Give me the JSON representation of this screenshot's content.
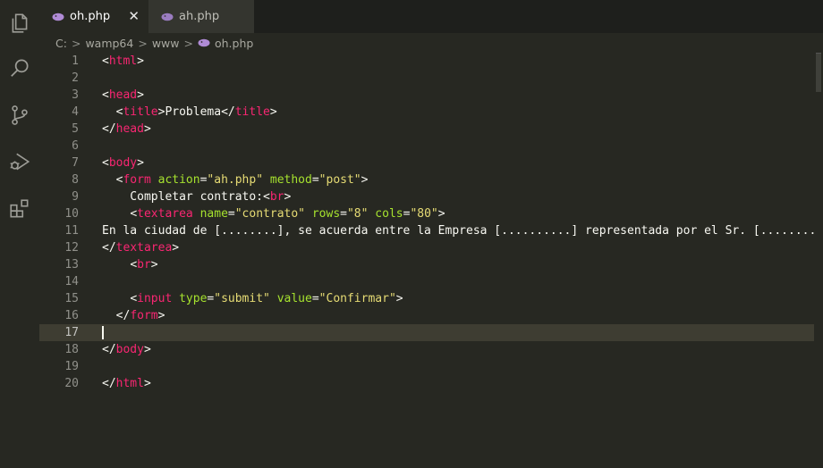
{
  "tabs": [
    {
      "label": "oh.php",
      "active": true
    },
    {
      "label": "ah.php",
      "active": false
    }
  ],
  "close_glyph": "✕",
  "breadcrumb": {
    "items": [
      "C:",
      "wamp64",
      "www",
      "oh.php"
    ],
    "separator": ">"
  },
  "editor": {
    "current_line": 17,
    "lines": [
      {
        "n": "1",
        "text": "<html>"
      },
      {
        "n": "2",
        "text": ""
      },
      {
        "n": "3",
        "text": "<head>"
      },
      {
        "n": "4",
        "text": "  <title>Problema</title>"
      },
      {
        "n": "5",
        "text": "</head>"
      },
      {
        "n": "6",
        "text": ""
      },
      {
        "n": "7",
        "text": "<body>"
      },
      {
        "n": "8",
        "text": "  <form action=\"ah.php\" method=\"post\">"
      },
      {
        "n": "9",
        "text": "    Completar contrato:<br>"
      },
      {
        "n": "10",
        "text": "    <textarea name=\"contrato\" rows=\"8\" cols=\"80\">"
      },
      {
        "n": "11",
        "text": "En la ciudad de [........], se acuerda entre la Empresa [..........] representada por el Sr. [.........."
      },
      {
        "n": "12",
        "text": "</textarea>"
      },
      {
        "n": "13",
        "text": "    <br>"
      },
      {
        "n": "14",
        "text": ""
      },
      {
        "n": "15",
        "text": "    <input type=\"submit\" value=\"Confirmar\">"
      },
      {
        "n": "16",
        "text": "  </form>"
      },
      {
        "n": "17",
        "text": ""
      },
      {
        "n": "18",
        "text": "</body>"
      },
      {
        "n": "19",
        "text": ""
      },
      {
        "n": "20",
        "text": "</html>"
      }
    ]
  },
  "colors": {
    "background": "#272822",
    "tag": "#f92672",
    "attribute": "#a6e22e",
    "string": "#e6db74",
    "text": "#f8f8f2",
    "php_icon": "#b08bd6"
  },
  "activity_icons": [
    "files-icon",
    "search-icon",
    "source-control-icon",
    "run-debug-icon",
    "extensions-icon"
  ]
}
